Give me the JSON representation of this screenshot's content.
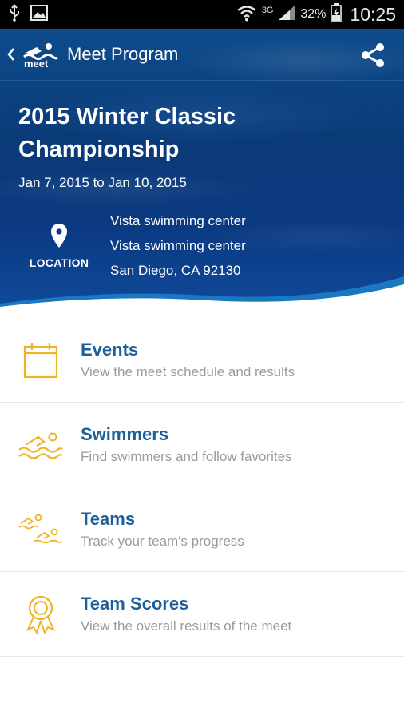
{
  "status_bar": {
    "network": "3G",
    "battery": "32%",
    "time": "10:25"
  },
  "toolbar": {
    "logo_text": "meet",
    "title": "Meet Program"
  },
  "meet": {
    "title": "2015 Winter Classic Championship",
    "dates": "Jan 7, 2015 to Jan 10, 2015",
    "location_label": "LOCATION",
    "location_lines": [
      "Vista swimming center",
      "Vista swimming center",
      "San Diego, CA 92130"
    ]
  },
  "menu": [
    {
      "title": "Events",
      "subtitle": "View the meet schedule and results",
      "icon": "calendar-icon"
    },
    {
      "title": "Swimmers",
      "subtitle": "Find swimmers and follow favorites",
      "icon": "swimmer-icon"
    },
    {
      "title": "Teams",
      "subtitle": "Track your team's progress",
      "icon": "team-swimmers-icon"
    },
    {
      "title": "Team Scores",
      "subtitle": "View the overall results of the meet",
      "icon": "award-ribbon-icon"
    }
  ],
  "colors": {
    "accent": "#f0b323",
    "title_blue": "#1f5f99",
    "hero_blue": "#0b3a82"
  }
}
